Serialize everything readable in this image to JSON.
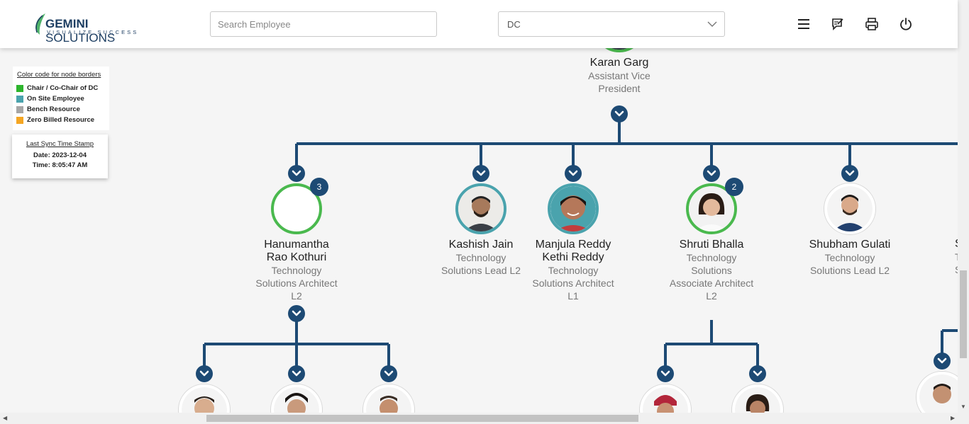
{
  "brand": {
    "name_bold": "GEMINI",
    "name_light": "SOLUTIONS",
    "tagline": "VISUALIZE SUCCESS",
    "colors": {
      "brand_navy": "#1d3e62",
      "leaf_green": "#4fb36a"
    }
  },
  "header": {
    "search": {
      "placeholder": "Search Employee",
      "value": ""
    },
    "dc_select": {
      "selected": "DC"
    },
    "icons": [
      "menu-icon",
      "feedback-icon",
      "print-icon",
      "power-icon"
    ]
  },
  "legend": {
    "title": "Color code for node borders",
    "items": [
      {
        "label": "Chair / Co-Chair of DC",
        "color": "#2db52d"
      },
      {
        "label": "On Site Employee",
        "color": "#4aa3ad"
      },
      {
        "label": "Bench Resource",
        "color": "#a6a6a6"
      },
      {
        "label": "Zero Billed Resource",
        "color": "#f5a623"
      }
    ]
  },
  "sync": {
    "title": "Last Sync Time Stamp",
    "date": "Date: 2023-12-04",
    "time": "Time: 8:05:47 AM"
  },
  "colors": {
    "connector": "#1d4a74",
    "chair_border": "#4ab94e",
    "onsite_border": "#4aa3ad"
  },
  "org": {
    "root": {
      "name": "Karan Garg",
      "role_lines": [
        "Assistant Vice",
        "President"
      ]
    },
    "children": [
      {
        "name_lines": [
          "Hanumantha",
          "Rao Kothuri"
        ],
        "role_lines": [
          "Technology",
          "Solutions Architect",
          "L2"
        ],
        "badge": "3",
        "border": "chair"
      },
      {
        "name_lines": [
          "Kashish Jain"
        ],
        "role_lines": [
          "Technology",
          "Solutions Lead L2"
        ],
        "badge": "",
        "border": "onsite"
      },
      {
        "name_lines": [
          "Manjula Reddy",
          "Kethi Reddy"
        ],
        "role_lines": [
          "Technology",
          "Solutions Architect",
          "L1"
        ],
        "badge": "",
        "border": "onsite"
      },
      {
        "name_lines": [
          "Shruti Bhalla"
        ],
        "role_lines": [
          "Technology",
          "Solutions",
          "Associate Architect",
          "L2"
        ],
        "badge": "2",
        "border": "chair"
      },
      {
        "name_lines": [
          "Shubham Gulati"
        ],
        "role_lines": [
          "Technology",
          "Solutions Lead L2"
        ],
        "badge": "",
        "border": "none"
      }
    ]
  },
  "scroll": {
    "horizontal_position_fraction": 0.21,
    "vertical_position_fraction": 0.66
  }
}
